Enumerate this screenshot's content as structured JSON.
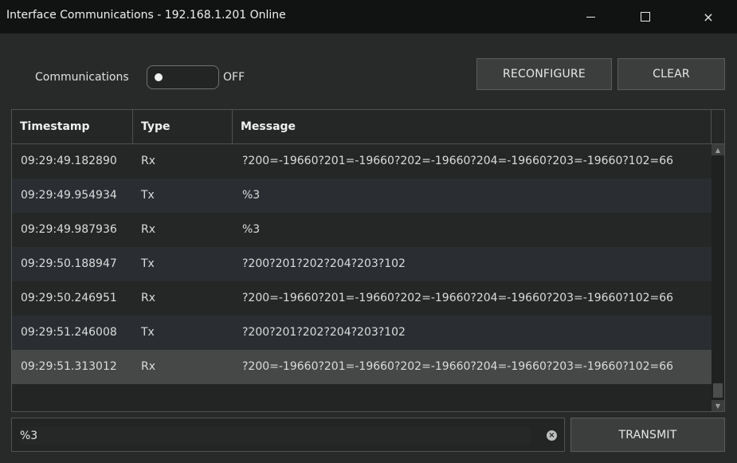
{
  "window": {
    "title": "Interface Communications - 192.168.1.201 Online",
    "minimize_glyph": "minimize-icon",
    "maximize_glyph": "maximize-icon",
    "close_glyph": "×"
  },
  "controls": {
    "communications_label": "Communications",
    "toggle_state": "OFF",
    "reconfigure_label": "RECONFIGURE",
    "clear_label": "CLEAR"
  },
  "table": {
    "columns": [
      "Timestamp",
      "Type",
      "Message"
    ],
    "rows": [
      {
        "timestamp": "09:29:49.182890",
        "type": "Rx",
        "message": "?200=-19660?201=-19660?202=-19660?204=-19660?203=-19660?102=66"
      },
      {
        "timestamp": "09:29:49.954934",
        "type": "Tx",
        "message": "%3"
      },
      {
        "timestamp": "09:29:49.987936",
        "type": "Rx",
        "message": "%3"
      },
      {
        "timestamp": "09:29:50.188947",
        "type": "Tx",
        "message": "?200?201?202?204?203?102"
      },
      {
        "timestamp": "09:29:50.246951",
        "type": "Rx",
        "message": "?200=-19660?201=-19660?202=-19660?204=-19660?203=-19660?102=66"
      },
      {
        "timestamp": "09:29:51.246008",
        "type": "Tx",
        "message": "?200?201?202?204?203?102"
      },
      {
        "timestamp": "09:29:51.313012",
        "type": "Rx",
        "message": "?200=-19660?201=-19660?202=-19660?204=-19660?203=-19660?102=66"
      }
    ]
  },
  "input": {
    "value": "%3"
  },
  "transmit_label": "TRANSMIT",
  "colors": {
    "background": "#272a28",
    "titlebar": "#111312",
    "selected_row": "#454846"
  }
}
